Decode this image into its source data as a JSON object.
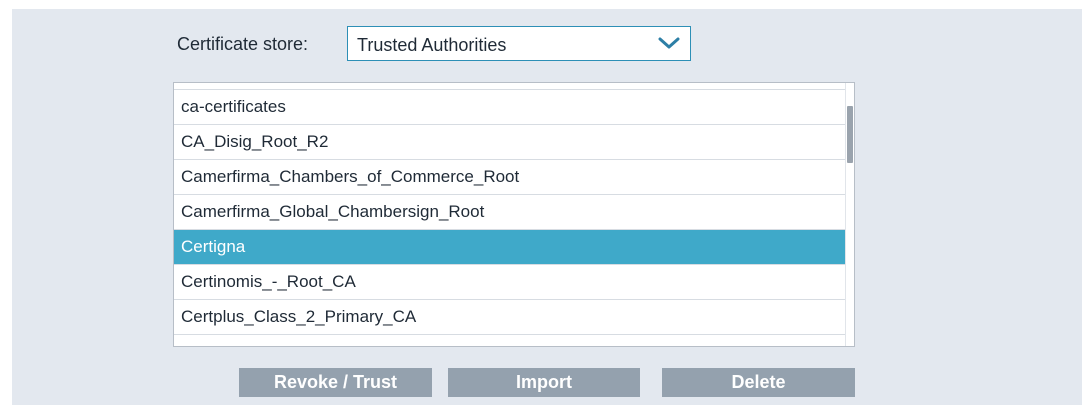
{
  "store": {
    "label": "Certificate store:",
    "selected": "Trusted Authorities"
  },
  "list": {
    "items": [
      {
        "label": "ca-certificates",
        "selected": false
      },
      {
        "label": "CA_Disig_Root_R2",
        "selected": false
      },
      {
        "label": "Camerfirma_Chambers_of_Commerce_Root",
        "selected": false
      },
      {
        "label": "Camerfirma_Global_Chambersign_Root",
        "selected": false
      },
      {
        "label": "Certigna",
        "selected": true
      },
      {
        "label": "Certinomis_-_Root_CA",
        "selected": false
      },
      {
        "label": "Certplus_Class_2_Primary_CA",
        "selected": false
      }
    ]
  },
  "buttons": {
    "revoke_trust": "Revoke / Trust",
    "import": "Import",
    "delete": "Delete"
  },
  "colors": {
    "panel_background": "#e3e8ef",
    "selection": "#3fa9c9",
    "button": "#94a1ae",
    "select_border": "#2d8fb6"
  },
  "icons": {
    "dropdown": "chevron-down-icon"
  }
}
